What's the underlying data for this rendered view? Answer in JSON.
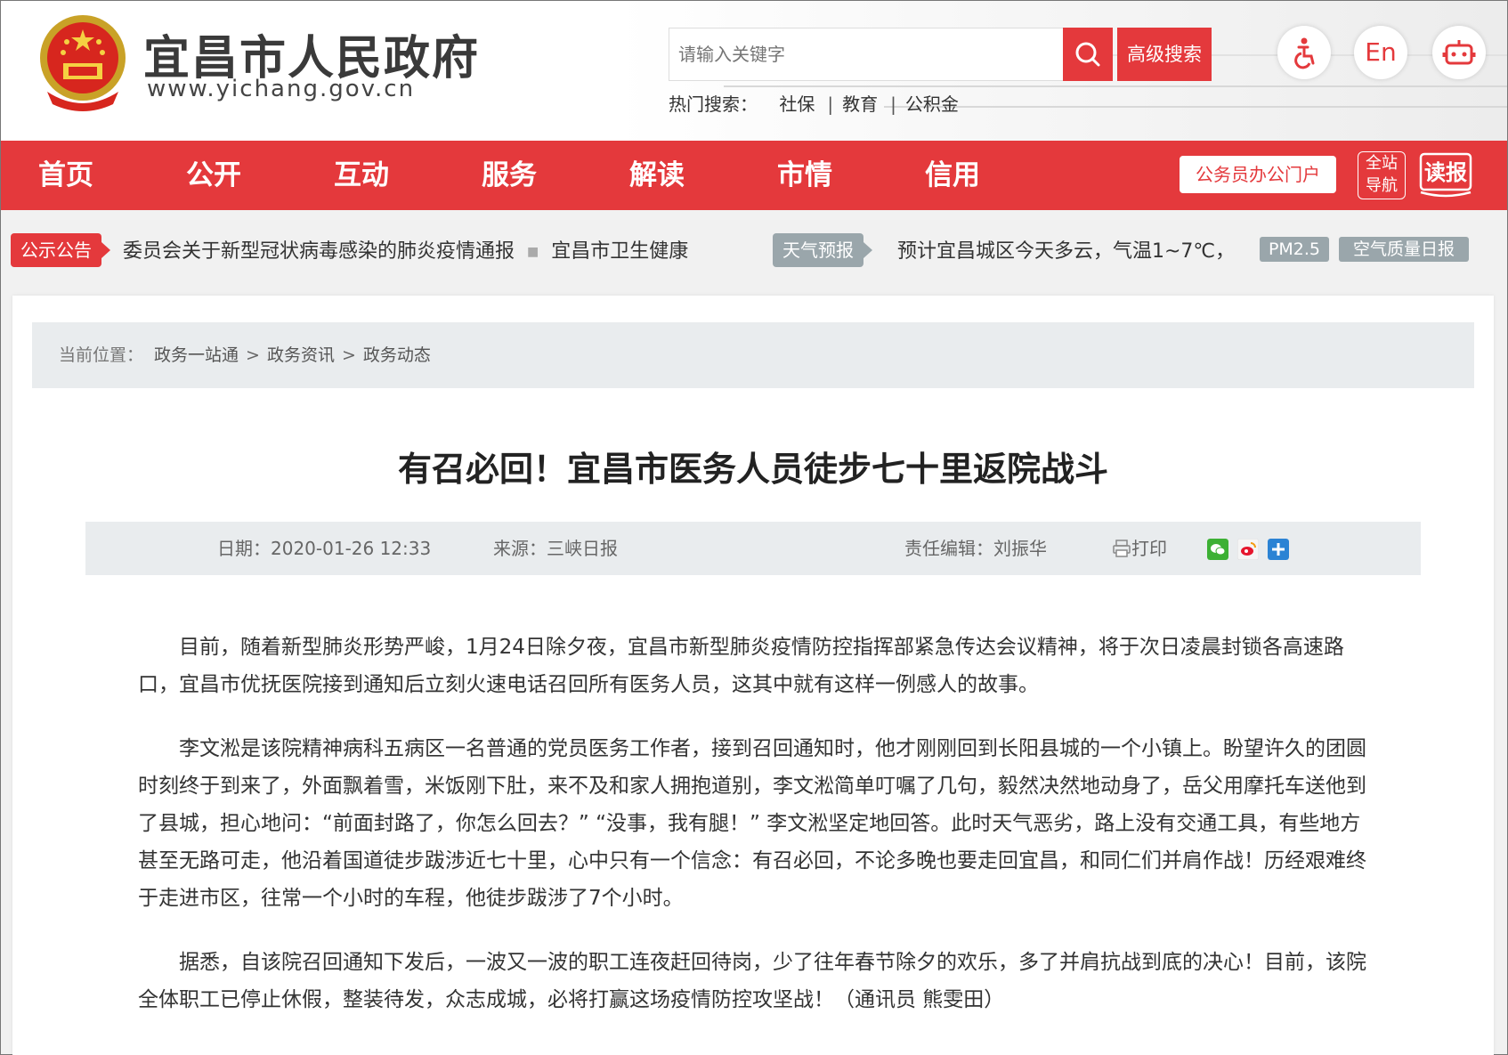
{
  "header": {
    "site_title": "宜昌市人民政府",
    "site_url": "www.yichang.gov.cn",
    "search_placeholder": "请输入关键字",
    "advanced_search": "高级搜索",
    "hot_label": "热门搜索：",
    "hot_items": [
      "社保",
      "教育",
      "公积金"
    ],
    "english_label": "En"
  },
  "nav": {
    "items": [
      "首页",
      "公开",
      "互动",
      "服务",
      "解读",
      "市情",
      "信用"
    ],
    "portal": "公务员办公门户",
    "allsite_line1": "全站",
    "allsite_line2": "导航",
    "read": "读报"
  },
  "notice": {
    "tag": "公示公告",
    "text1": "委员会关于新型冠状病毒感染的肺炎疫情通报",
    "text2": "宜昌市卫生健康",
    "weather_tag": "天气预报",
    "weather_text": "预计宜昌城区今天多云，气温1~7℃，",
    "pm": "PM2.5",
    "aq": "空气质量日报"
  },
  "breadcrumb": {
    "label": "当前位置：",
    "items": [
      "政务一站通",
      "政务资讯",
      "政务动态"
    ]
  },
  "article": {
    "title": "有召必回！宜昌市医务人员徒步七十里返院战斗",
    "date": "日期：2020-01-26 12:33",
    "source": "来源：三峡日报",
    "editor": "责任编辑：刘振华",
    "print": "打印",
    "paragraphs": [
      "目前，随着新型肺炎形势严峻，1月24日除夕夜，宜昌市新型肺炎疫情防控指挥部紧急传达会议精神，将于次日凌晨封锁各高速路口，宜昌市优抚医院接到通知后立刻火速电话召回所有医务人员，这其中就有这样一例感人的故事。",
      "李文淞是该院精神病科五病区一名普通的党员医务工作者，接到召回通知时，他才刚刚回到长阳县城的一个小镇上。盼望许久的团圆时刻终于到来了，外面飘着雪，米饭刚下肚，来不及和家人拥抱道别，李文淞简单叮嘱了几句，毅然决然地动身了，岳父用摩托车送他到了县城，担心地问：“前面封路了，你怎么回去？” “没事，我有腿！” 李文淞坚定地回答。此时天气恶劣，路上没有交通工具，有些地方甚至无路可走，他沿着国道徒步跋涉近七十里，心中只有一个信念：有召必回，不论多晚也要走回宜昌，和同仁们并肩作战！历经艰难终于走进市区，往常一个小时的车程，他徒步跋涉了7个小时。",
      "据悉，自该院召回通知下发后，一波又一波的职工连夜赶回待岗，少了往年春节除夕的欢乐，多了并肩抗战到底的决心！目前，该院全体职工已停止休假，整装待发，众志成城，必将打赢这场疫情防控攻坚战！（通讯员 熊雯田）"
    ]
  },
  "colors": {
    "brand_red": "#e4393c",
    "tag_gray": "#9aa6ab",
    "panel_gray": "#e9ecee"
  },
  "icons": [
    "national-emblem-icon",
    "search-icon",
    "accessibility-icon",
    "robot-icon",
    "newspaper-icon",
    "print-icon",
    "wechat-icon",
    "weibo-icon",
    "plus-share-icon"
  ]
}
